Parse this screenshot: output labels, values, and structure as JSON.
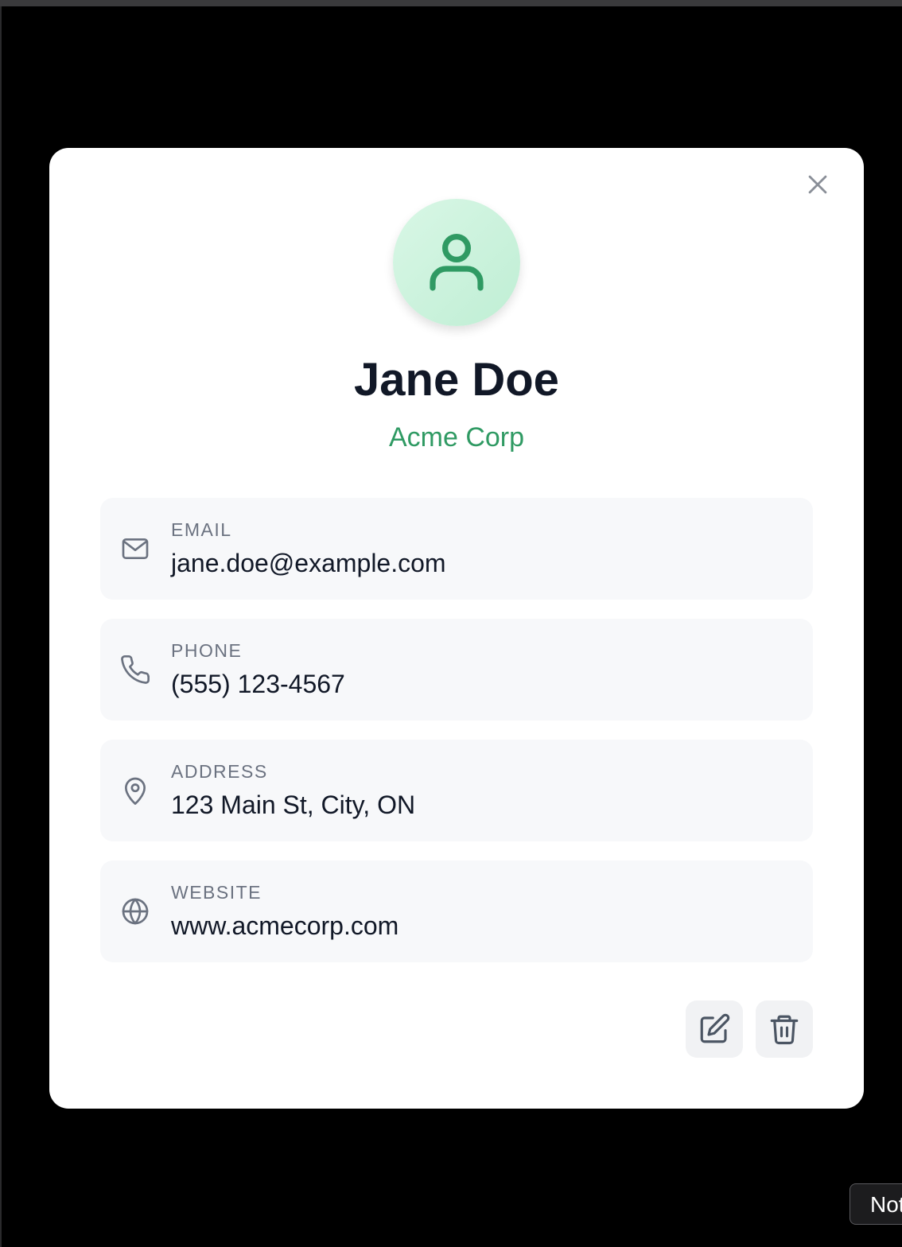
{
  "contact": {
    "name": "Jane Doe",
    "company": "Acme Corp",
    "fields": [
      {
        "label": "EMAIL",
        "value": "jane.doe@example.com",
        "icon": "mail-icon"
      },
      {
        "label": "PHONE",
        "value": "(555) 123-4567",
        "icon": "phone-icon"
      },
      {
        "label": "ADDRESS",
        "value": "123 Main St, City, ON",
        "icon": "map-pin-icon"
      },
      {
        "label": "WEBSITE",
        "value": "www.acmecorp.com",
        "icon": "globe-icon"
      }
    ]
  },
  "modal": {
    "close_icon": "close-icon",
    "edit_icon": "edit-icon",
    "delete_icon": "trash-icon"
  },
  "toast": {
    "text": "Not"
  },
  "colors": {
    "accent": "#2f9a63",
    "avatar_bg": "#c9f2dc",
    "card_bg": "#f7f8fa",
    "overlay": "#000000"
  }
}
